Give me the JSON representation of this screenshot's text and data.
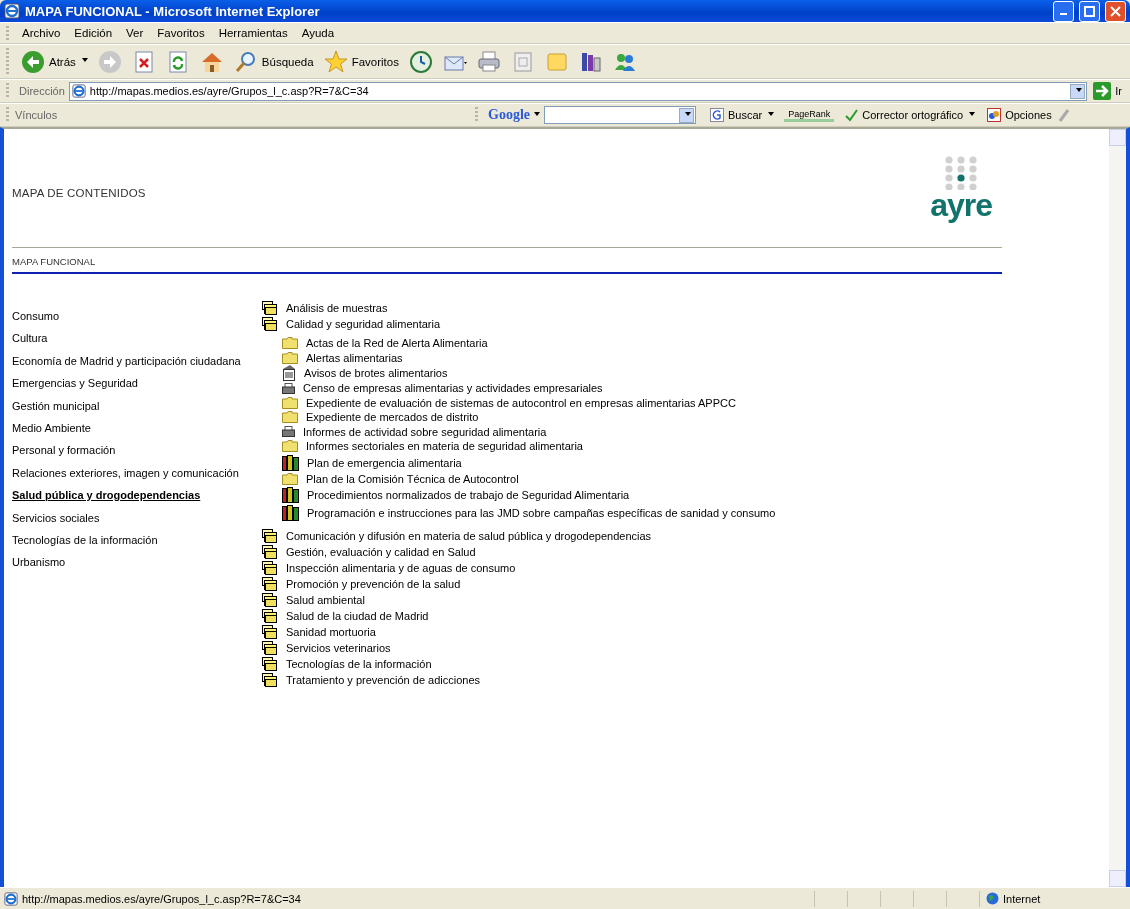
{
  "window": {
    "title": "MAPA FUNCIONAL - Microsoft Internet Explorer"
  },
  "menu": [
    "Archivo",
    "Edición",
    "Ver",
    "Favoritos",
    "Herramientas",
    "Ayuda"
  ],
  "toolbar": [
    {
      "kind": "back",
      "label": "Atrás"
    },
    {
      "kind": "forward"
    },
    {
      "kind": "stop"
    },
    {
      "kind": "refresh"
    },
    {
      "kind": "home"
    },
    {
      "kind": "search",
      "label": "Búsqueda"
    },
    {
      "kind": "favorites",
      "label": "Favoritos"
    },
    {
      "kind": "history"
    },
    {
      "kind": "mail"
    },
    {
      "kind": "print"
    },
    {
      "kind": "word"
    },
    {
      "kind": "note"
    },
    {
      "kind": "research"
    },
    {
      "kind": "messenger"
    }
  ],
  "address": {
    "label": "Dirección",
    "url": "http://mapas.medios.es/ayre/Grupos_l_c.asp?R=7&C=34",
    "go": "Ir"
  },
  "links": {
    "label": "Vínculos"
  },
  "google": {
    "logo": "Google",
    "search": "Buscar",
    "pagerank": "PageRank",
    "spell": "Corrector ortográfico",
    "options": "Opciones"
  },
  "page": {
    "heading": "MAPA DE CONTENIDOS",
    "logo": "ayre",
    "section": "MAPA FUNCIONAL",
    "nav": [
      {
        "label": "Consumo",
        "selected": false
      },
      {
        "label": "Cultura",
        "selected": false
      },
      {
        "label": "Economía de Madrid y participación ciudadana",
        "selected": false
      },
      {
        "label": "Emergencias y Seguridad",
        "selected": false
      },
      {
        "label": "Gestión municipal",
        "selected": false
      },
      {
        "label": "Medio Ambiente",
        "selected": false
      },
      {
        "label": "Personal y formación",
        "selected": false
      },
      {
        "label": "Relaciones exteriores, imagen y comunicación",
        "selected": false
      },
      {
        "label": "Salud pública y drogodependencias",
        "selected": true
      },
      {
        "label": "Servicios sociales",
        "selected": false
      },
      {
        "label": "Tecnologías de la información",
        "selected": false
      },
      {
        "label": "Urbanismo",
        "selected": false
      }
    ],
    "tree": [
      {
        "label": "Análisis de muestras",
        "kind": "group"
      },
      {
        "label": "Calidad y seguridad alimentaria",
        "kind": "group",
        "children": [
          {
            "label": "Actas de la Red de Alerta Alimentaria",
            "kind": "folder"
          },
          {
            "label": "Alertas alimentarias",
            "kind": "folder"
          },
          {
            "label": "Avisos de brotes alimentarios",
            "kind": "document"
          },
          {
            "label": "Censo de empresas alimentarias y actividades empresariales",
            "kind": "printer"
          },
          {
            "label": "Expediente de evaluación de sistemas de autocontrol en empresas alimentarias APPCC",
            "kind": "folder"
          },
          {
            "label": "Expediente de mercados de distrito",
            "kind": "folder"
          },
          {
            "label": "Informes de actividad sobre seguridad alimentaria",
            "kind": "printer"
          },
          {
            "label": "Informes sectoriales en materia de seguridad alimentaria",
            "kind": "folder"
          },
          {
            "label": "Plan de emergencia alimentaria",
            "kind": "books"
          },
          {
            "label": "Plan de la Comisión Técnica de Autocontrol",
            "kind": "folder"
          },
          {
            "label": "Procedimientos normalizados de trabajo de Seguridad Alimentaria",
            "kind": "books"
          },
          {
            "label": "Programación e instrucciones para las JMD sobre campañas específicas de sanidad y consumo",
            "kind": "books"
          }
        ]
      },
      {
        "label": "Comunicación y difusión en materia de salud pública y drogodependencias",
        "kind": "group"
      },
      {
        "label": "Gestión, evaluación y calidad en Salud",
        "kind": "group"
      },
      {
        "label": "Inspección alimentaria y de aguas de consumo",
        "kind": "group"
      },
      {
        "label": "Promoción y prevención de la salud",
        "kind": "group"
      },
      {
        "label": "Salud ambiental",
        "kind": "group"
      },
      {
        "label": "Salud de la ciudad de Madrid",
        "kind": "group"
      },
      {
        "label": "Sanidad mortuoria",
        "kind": "group"
      },
      {
        "label": "Servicios veterinarios",
        "kind": "group"
      },
      {
        "label": "Tecnologías de la información",
        "kind": "group"
      },
      {
        "label": "Tratamiento y prevención de adicciones",
        "kind": "group"
      }
    ]
  },
  "status": {
    "url": "http://mapas.medios.es/ayre/Grupos_l_c.asp?R=7&C=34",
    "zone": "Internet"
  }
}
